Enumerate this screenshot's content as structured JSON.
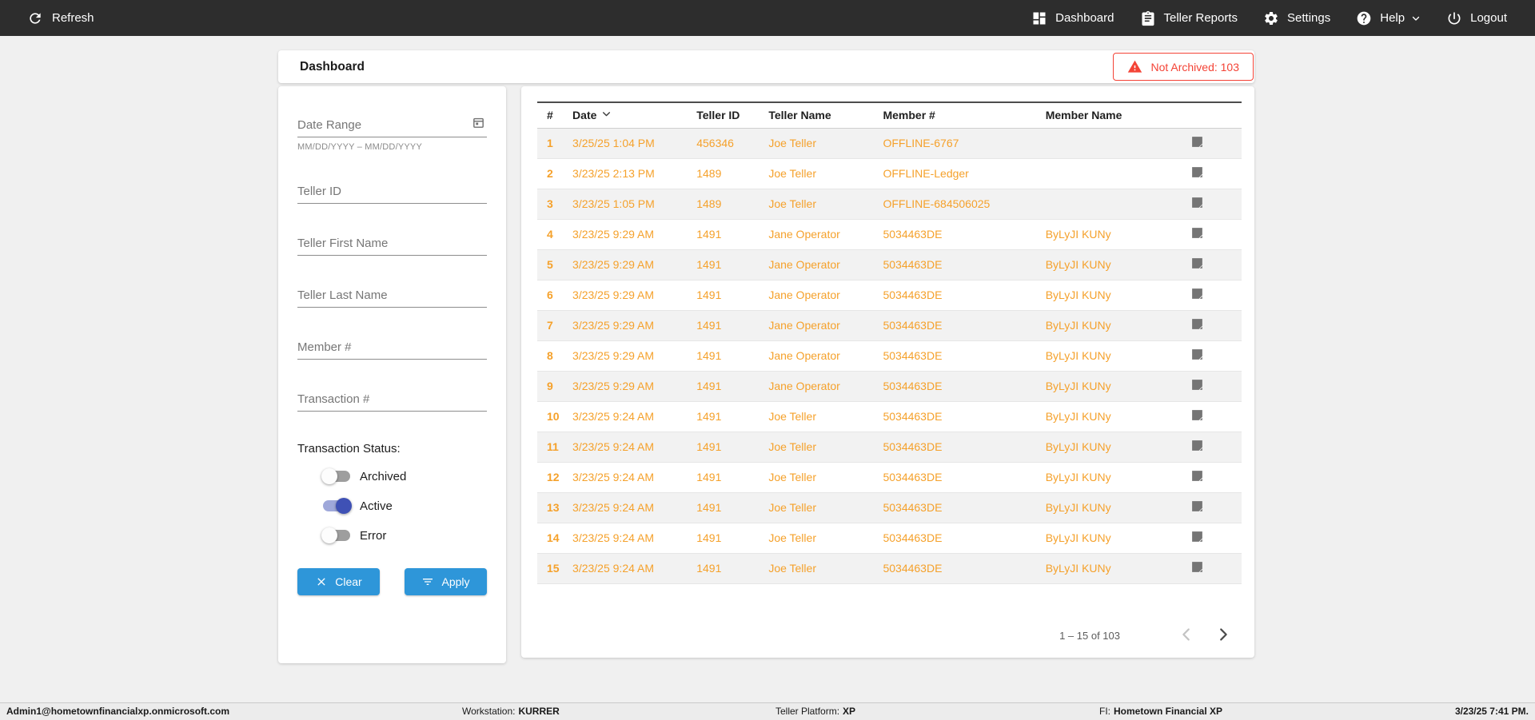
{
  "navbar": {
    "refresh": {
      "label": "Refresh",
      "icon": "refresh-icon"
    },
    "items": [
      {
        "label": "Dashboard",
        "icon": "dashboard-icon"
      },
      {
        "label": "Teller Reports",
        "icon": "teller-reports-icon"
      },
      {
        "label": "Settings",
        "icon": "gear-icon"
      },
      {
        "label": "Help",
        "icon": "help-icon",
        "dropdown": true
      },
      {
        "label": "Logout",
        "icon": "power-icon"
      }
    ]
  },
  "header": {
    "title": "Dashboard",
    "not_archived_badge": {
      "label": "Not Archived: 103",
      "count": 103,
      "icon": "warning-icon",
      "color": "#F44336"
    }
  },
  "filters": {
    "date_range": {
      "placeholder": "Date Range",
      "value": "",
      "helper": "MM/DD/YYYY – MM/DD/YYYY",
      "icon": "calendar-icon"
    },
    "text_fields": [
      {
        "name": "teller-id",
        "placeholder": "Teller ID",
        "value": ""
      },
      {
        "name": "teller-first-name",
        "placeholder": "Teller First Name",
        "value": ""
      },
      {
        "name": "teller-last-name",
        "placeholder": "Teller Last Name",
        "value": ""
      },
      {
        "name": "member-number",
        "placeholder": "Member #",
        "value": ""
      },
      {
        "name": "transaction-number",
        "placeholder": "Transaction #",
        "value": ""
      }
    ],
    "status": {
      "label": "Transaction Status:",
      "toggles": [
        {
          "label": "Archived",
          "on": false
        },
        {
          "label": "Active",
          "on": true
        },
        {
          "label": "Error",
          "on": false
        }
      ]
    },
    "buttons": {
      "clear": "Clear",
      "apply": "Apply",
      "clear_icon": "x-icon",
      "apply_icon": "filter-icon"
    }
  },
  "table": {
    "columns": [
      "#",
      "Date",
      "Teller ID",
      "Teller Name",
      "Member #",
      "Member Name"
    ],
    "sort": {
      "column": "Date",
      "direction": "desc"
    },
    "row_icon": "note-icon",
    "rows": [
      {
        "num": "1",
        "date": "3/25/25 1:04 PM",
        "teller_id": "456346",
        "teller_name": "Joe Teller",
        "member_num": "OFFLINE-6767",
        "member_name": ""
      },
      {
        "num": "2",
        "date": "3/23/25 2:13 PM",
        "teller_id": "1489",
        "teller_name": "Joe Teller",
        "member_num": "OFFLINE-Ledger",
        "member_name": ""
      },
      {
        "num": "3",
        "date": "3/23/25 1:05 PM",
        "teller_id": "1489",
        "teller_name": "Joe Teller",
        "member_num": "OFFLINE-684506025",
        "member_name": ""
      },
      {
        "num": "4",
        "date": "3/23/25 9:29 AM",
        "teller_id": "1491",
        "teller_name": "Jane Operator",
        "member_num": "5034463DE",
        "member_name": "ByLyJI KUNy"
      },
      {
        "num": "5",
        "date": "3/23/25 9:29 AM",
        "teller_id": "1491",
        "teller_name": "Jane Operator",
        "member_num": "5034463DE",
        "member_name": "ByLyJI KUNy"
      },
      {
        "num": "6",
        "date": "3/23/25 9:29 AM",
        "teller_id": "1491",
        "teller_name": "Jane Operator",
        "member_num": "5034463DE",
        "member_name": "ByLyJI KUNy"
      },
      {
        "num": "7",
        "date": "3/23/25 9:29 AM",
        "teller_id": "1491",
        "teller_name": "Jane Operator",
        "member_num": "5034463DE",
        "member_name": "ByLyJI KUNy"
      },
      {
        "num": "8",
        "date": "3/23/25 9:29 AM",
        "teller_id": "1491",
        "teller_name": "Jane Operator",
        "member_num": "5034463DE",
        "member_name": "ByLyJI KUNy"
      },
      {
        "num": "9",
        "date": "3/23/25 9:29 AM",
        "teller_id": "1491",
        "teller_name": "Jane Operator",
        "member_num": "5034463DE",
        "member_name": "ByLyJI KUNy"
      },
      {
        "num": "10",
        "date": "3/23/25 9:24 AM",
        "teller_id": "1491",
        "teller_name": "Joe Teller",
        "member_num": "5034463DE",
        "member_name": "ByLyJI KUNy"
      },
      {
        "num": "11",
        "date": "3/23/25 9:24 AM",
        "teller_id": "1491",
        "teller_name": "Joe Teller",
        "member_num": "5034463DE",
        "member_name": "ByLyJI KUNy"
      },
      {
        "num": "12",
        "date": "3/23/25 9:24 AM",
        "teller_id": "1491",
        "teller_name": "Joe Teller",
        "member_num": "5034463DE",
        "member_name": "ByLyJI KUNy"
      },
      {
        "num": "13",
        "date": "3/23/25 9:24 AM",
        "teller_id": "1491",
        "teller_name": "Joe Teller",
        "member_num": "5034463DE",
        "member_name": "ByLyJI KUNy"
      },
      {
        "num": "14",
        "date": "3/23/25 9:24 AM",
        "teller_id": "1491",
        "teller_name": "Joe Teller",
        "member_num": "5034463DE",
        "member_name": "ByLyJI KUNy"
      },
      {
        "num": "15",
        "date": "3/23/25 9:24 AM",
        "teller_id": "1491",
        "teller_name": "Joe Teller",
        "member_num": "5034463DE",
        "member_name": "ByLyJI KUNy"
      }
    ],
    "pagination": {
      "range_label": "1 – 15 of 103",
      "prev_enabled": false,
      "next_enabled": true
    }
  },
  "footer": {
    "user": "Admin1@hometownfinancialxp.onmicrosoft.com",
    "workstation": {
      "label": "Workstation:",
      "value": "KURRER"
    },
    "teller_platform": {
      "label": "Teller Platform:",
      "value": "XP"
    },
    "fi": {
      "label": "FI:",
      "value": "Hometown Financial XP"
    },
    "timestamp": "3/23/25 7:41 PM."
  },
  "colors": {
    "navbar_bg": "#2D2D2D",
    "accent_orange": "#F5A12B",
    "button_blue": "#2E96D9",
    "toggle_on_indigo": "#3F51B5",
    "alert_red": "#F44336",
    "row_stripe": "#F2F2F2"
  }
}
